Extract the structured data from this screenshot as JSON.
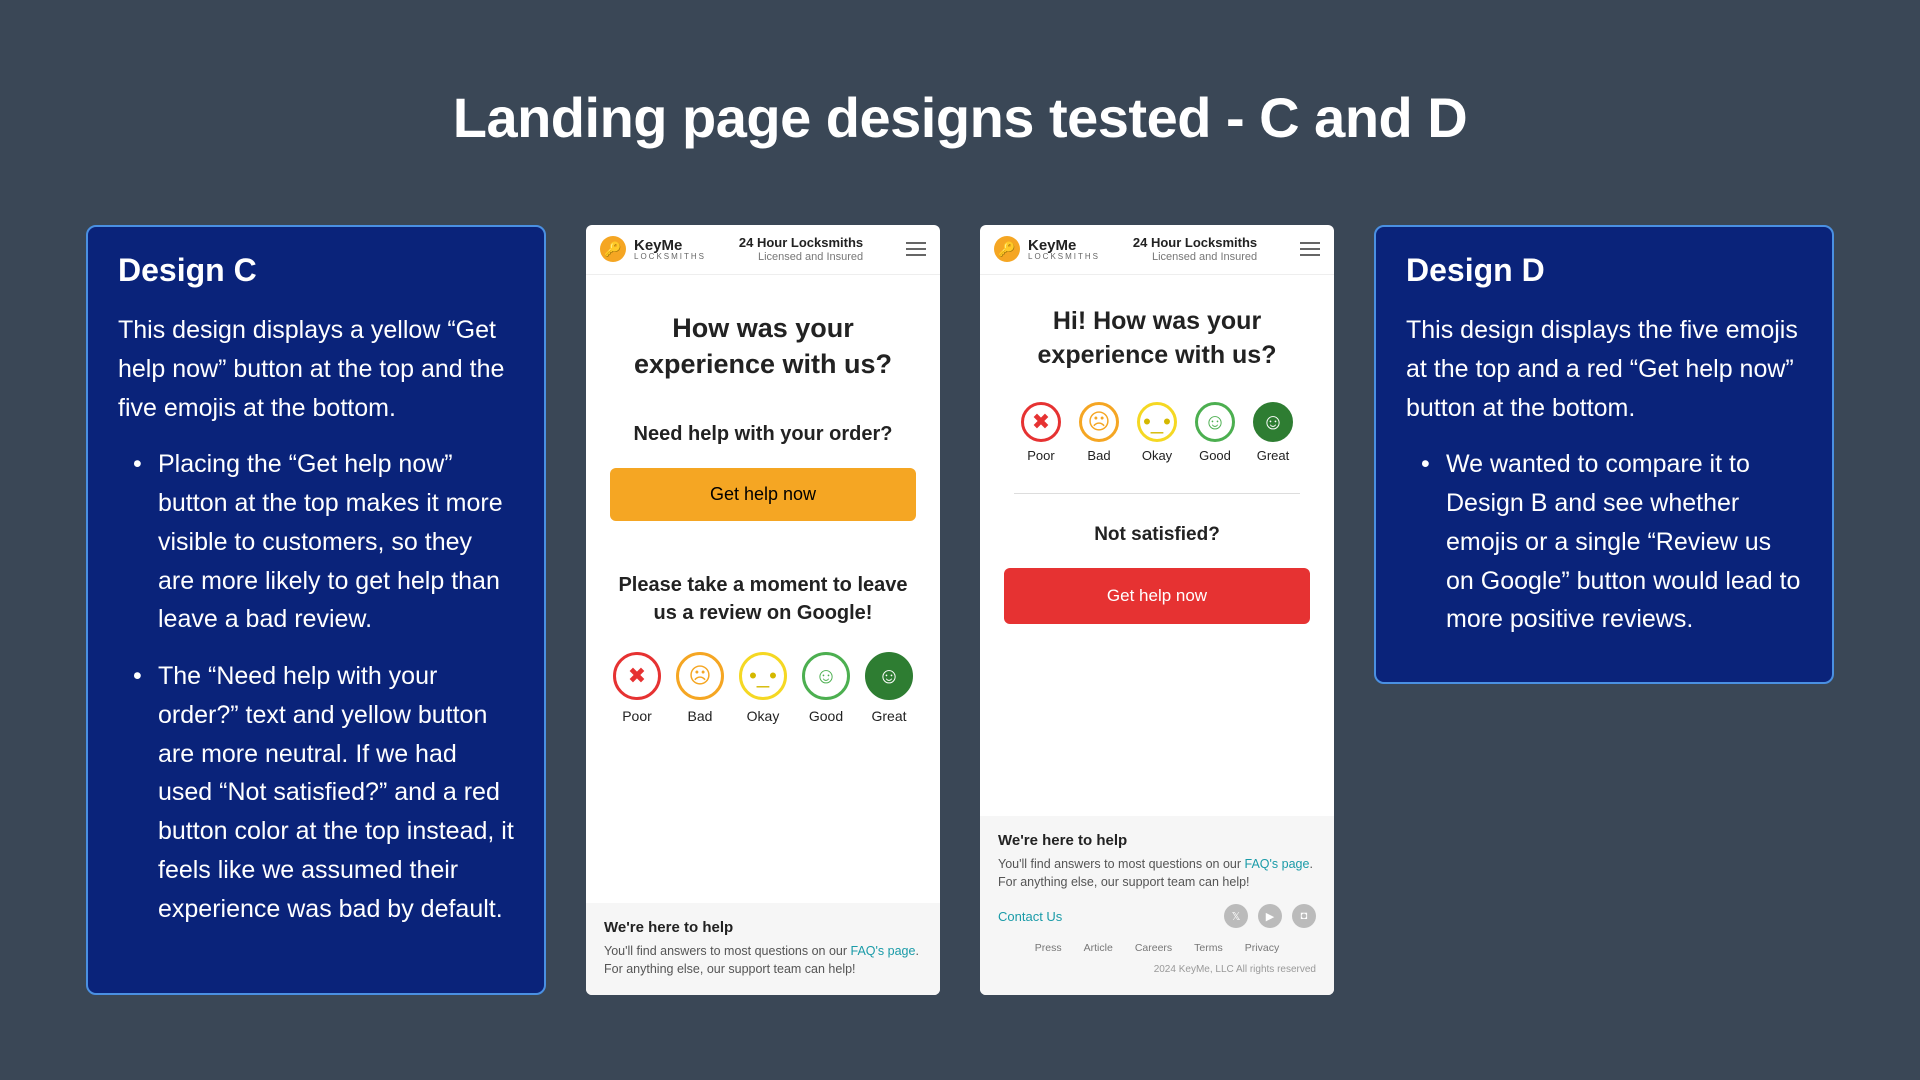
{
  "title": "Landing page designs tested - C and D",
  "designC": {
    "heading": "Design C",
    "intro": "This design displays a yellow “Get help now” button at the top and the five emojis at the bottom.",
    "bullet1": "Placing the “Get help now” button at the top makes it more visible to customers, so they are more likely to get help than leave a bad review.",
    "bullet2": "The “Need help with your order?” text and yellow button are more neutral. If we had used “Not satisfied?” and a red button color at the top instead, it feels like we assumed their experience was bad by default."
  },
  "designD": {
    "heading": "Design D",
    "intro": "This design displays the five emojis at the top and a red “Get help now” button at the bottom.",
    "bullet1": "We wanted to compare it to Design B and see whether emojis or a single “Review us on Google” button would lead to more positive reviews."
  },
  "mock": {
    "brandName": "KeyMe",
    "brandSub": "LOCKSMITHS",
    "tag1": "24 Hour Locksmiths",
    "tag2": "Licensed and Insured",
    "cQuestion": "How was your experience with us?",
    "cHelpPrompt": "Need help with your order?",
    "getHelp": "Get help now",
    "cReviewPrompt": "Please take a moment to leave us a review on Google!",
    "dQuestion": "Hi! How was your experience with us?",
    "dNotSat": "Not satisfied?",
    "emoji": {
      "poor": "Poor",
      "bad": "Bad",
      "okay": "Okay",
      "good": "Good",
      "great": "Great"
    },
    "footer": {
      "heading": "We're here to help",
      "text1": "You'll find answers to most questions on our ",
      "faq": "FAQ's page",
      "text2": ". For anything else, our support team can help!",
      "contact": "Contact Us",
      "legal": {
        "press": "Press",
        "article": "Article",
        "careers": "Careers",
        "terms": "Terms",
        "privacy": "Privacy"
      },
      "copyright": "2024 KeyMe, LLC All rights reserved"
    }
  }
}
